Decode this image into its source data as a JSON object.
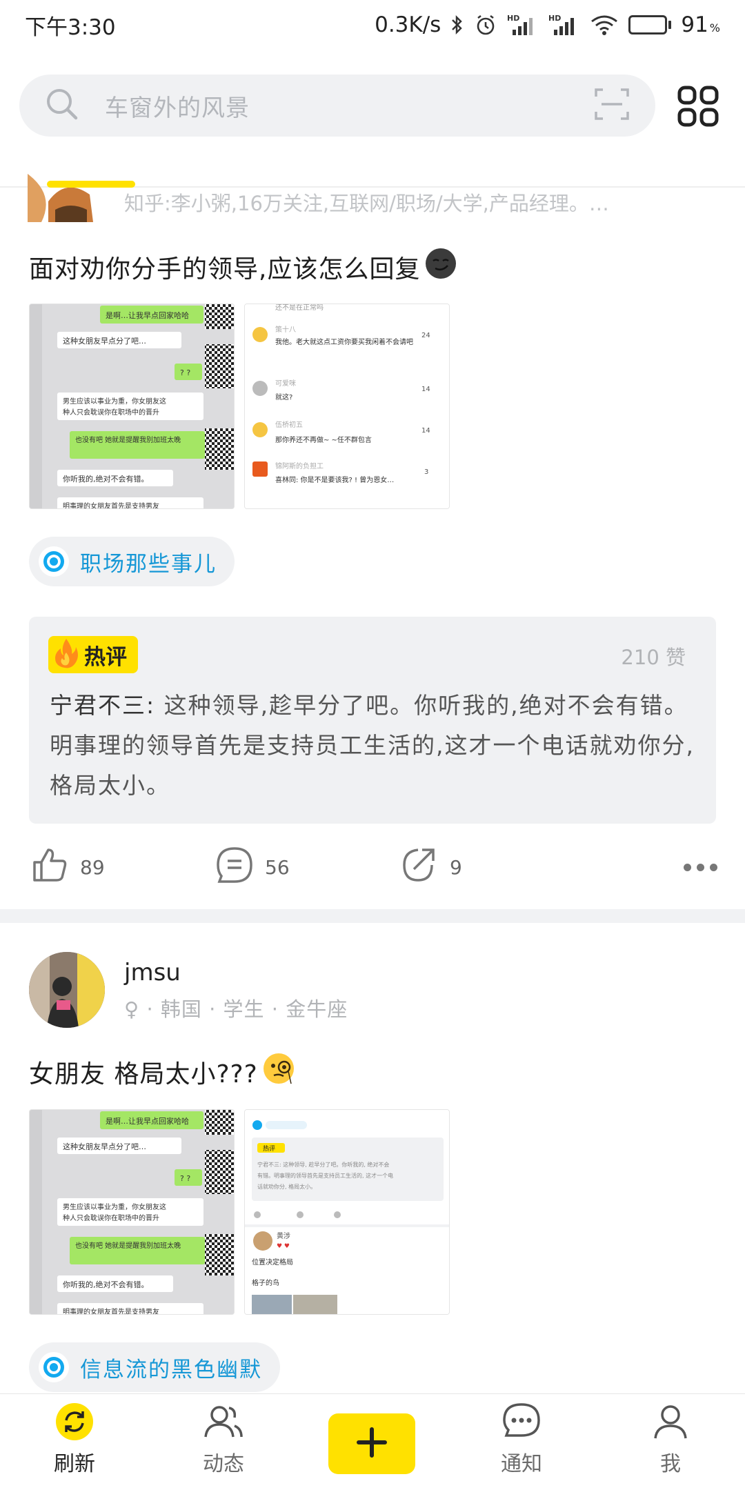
{
  "status_bar": {
    "time": "下午3:30",
    "net_speed": "0.3K/s",
    "hd1": "HD",
    "hd2": "HD",
    "battery": "91",
    "battery_unit": "%",
    "battery_level": 0.91
  },
  "search": {
    "placeholder": "车窗外的风景"
  },
  "post1": {
    "author_meta": "知乎:李小粥,16万关注,互联网/职场/大学,产品经理。…",
    "title": "面对劝你分手的领导,应该怎么回复",
    "topic": "职场那些事儿",
    "hot_comment": {
      "badge": "热评",
      "likes": "210 赞",
      "author": "宁君不三:",
      "text": " 这种领导,趁早分了吧。你听我的,绝对不会有错。明事理的领导首先是支持员工生活的,这才一个电话就劝你分,格局太小。"
    },
    "actions": {
      "likes": "89",
      "comments": "56",
      "shares": "9"
    },
    "chat_image": {
      "lines": [
        "是啊…让我早点回家哈哈",
        "这种女朋友早点分了吧…",
        "? ?",
        "男生应该以事业为重,你女朋友这种人只会耽误你在职场中的晋升",
        "也没有吧 她就是提醒我别加班太晚",
        "你听我的,绝对不会有错。",
        "明事理的女朋友首先是支持男友"
      ]
    },
    "comment_image": {
      "top": "还不是在正常吗",
      "rows": [
        {
          "name": "策十八",
          "count": "24",
          "text": "我他。老大就这点工资你要买我闲着不会请吧"
        },
        {
          "name": "可爱咪",
          "count": "14",
          "text": "就这?"
        },
        {
          "name": "伍桥初五",
          "count": "14",
          "text": "那你养还不再做~ ~任不群包言"
        },
        {
          "name": "锦阿斯的负担工",
          "count": "3",
          "text": "喜林同: 你是不是要该我? ! 曾为恩女…"
        }
      ]
    }
  },
  "post2": {
    "username": "jmsu",
    "sub": "♀ · 韩国 · 学生 · 金牛座",
    "title": "女朋友 格局太小???",
    "topic": "信息流的黑色幽默",
    "shared_image": {
      "badge": "热评",
      "text": "宁君不三: 这种领导, 趁早分了吧。你听我的, 绝对不会有错。明事理的领导首先是支持员工生活的, 这才一个电话就劝你分, 格局太小。",
      "user": "黄涉",
      "caption": "位置决定格局",
      "caption2": "格子的鸟"
    }
  },
  "bottom_nav": {
    "refresh": "刷新",
    "feed": "动态",
    "notify": "通知",
    "me": "我"
  },
  "colors": {
    "brand_yellow": "#ffe100",
    "topic_blue": "#1597d6",
    "chat_green": "#a4e664"
  }
}
